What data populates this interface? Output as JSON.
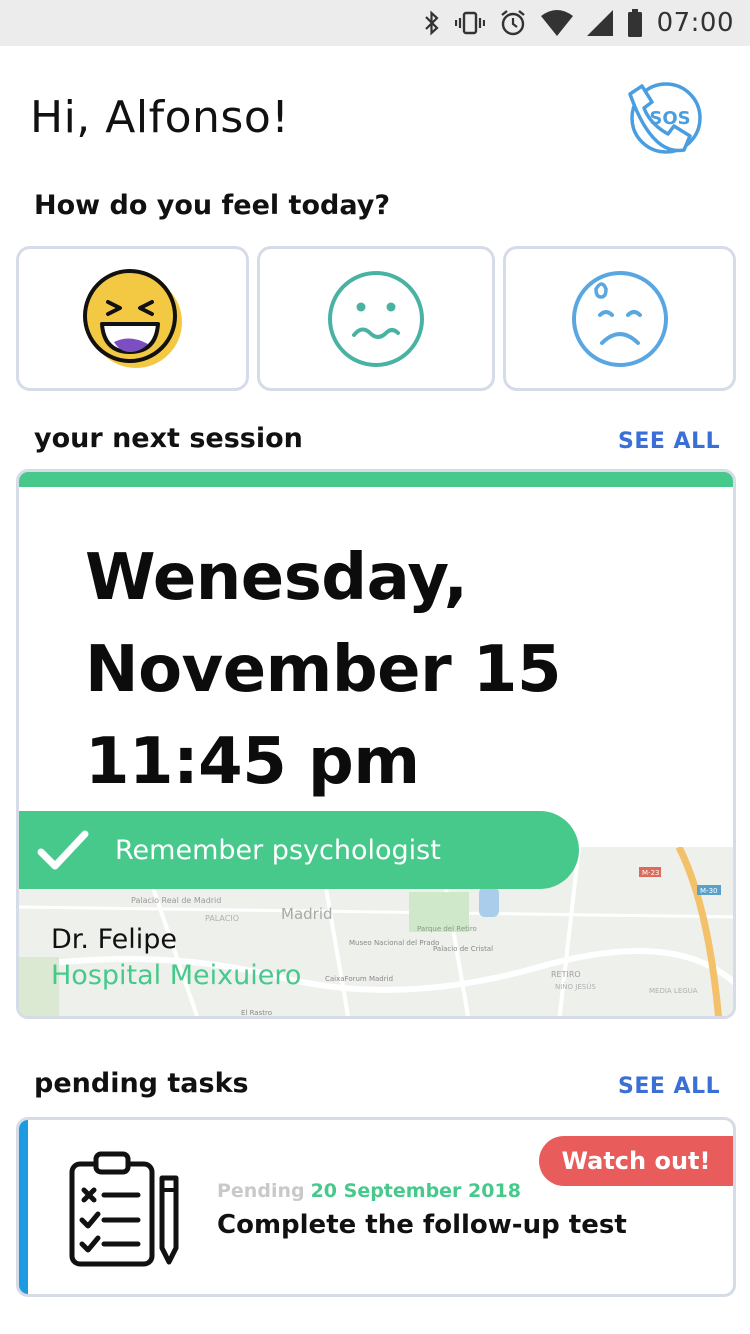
{
  "status_bar": {
    "time": "07:00",
    "icons": [
      "bluetooth-icon",
      "vibrate-icon",
      "alarm-icon",
      "wifi-icon",
      "signal-icon",
      "battery-icon"
    ]
  },
  "header": {
    "greeting": "Hi, Alfonso!",
    "sos_label": "SOS",
    "sos_color": "#4a9ee0"
  },
  "mood": {
    "question": "How do you feel today?",
    "options": [
      {
        "icon": "laughing-face-icon",
        "color": "#f3c843"
      },
      {
        "icon": "queasy-face-icon",
        "color": "#4ab2a2"
      },
      {
        "icon": "sad-sweat-face-icon",
        "color": "#5aa6e0"
      }
    ]
  },
  "next_session": {
    "title": "your next session",
    "see_all": "SEE ALL",
    "date_line1": "Wenesday,",
    "date_line2": "November 15",
    "time": "11:45 pm",
    "reminder": "Remember psychologist",
    "doctor": "Dr. Felipe",
    "hospital": "Hospital Meixuiero",
    "map_labels": [
      "Madrid",
      "Palacio Real de Madrid",
      "PALACIO",
      "Parque del Retiro",
      "Museo Nacional del Prado",
      "Palacio de Cristal",
      "CaixaForum Madrid",
      "RETIRO",
      "NIÑO JESÚS",
      "El Rastro",
      "M-30",
      "M-23",
      "MEDIA LEGUA"
    ],
    "accent_color": "#47c98c"
  },
  "pending_tasks": {
    "title": "pending tasks",
    "see_all": "SEE ALL",
    "items": [
      {
        "badge": "Watch out!",
        "status": "Pending",
        "date": "20 September 2018",
        "title": "Complete the follow-up test"
      }
    ],
    "badge_color": "#e85c5c",
    "bar_color": "#1e9be0"
  }
}
